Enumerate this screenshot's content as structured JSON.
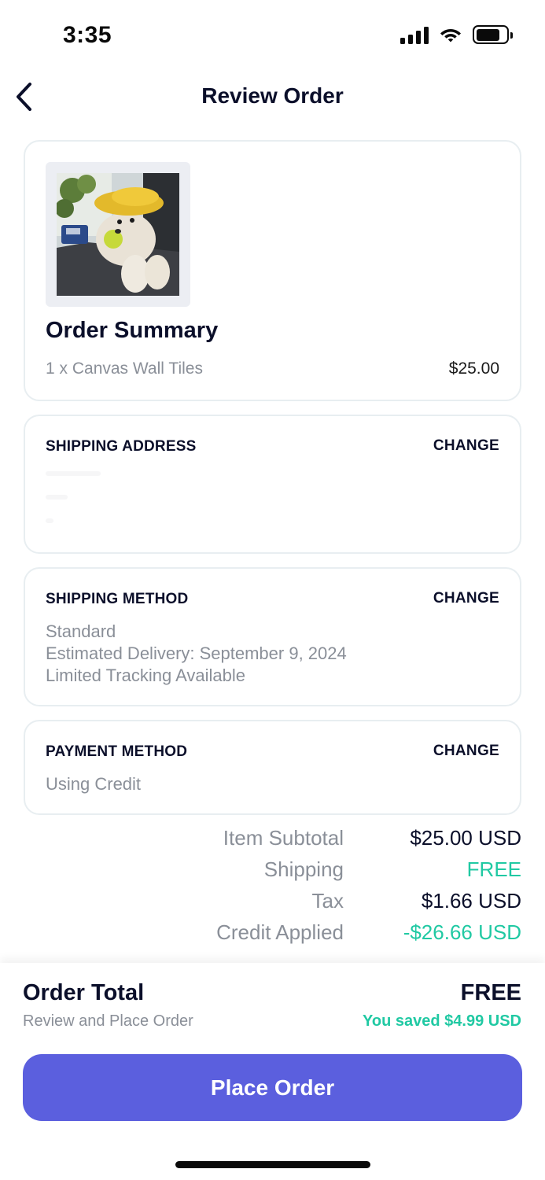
{
  "status_bar": {
    "time": "3:35"
  },
  "header": {
    "title": "Review Order"
  },
  "order_summary": {
    "title": "Order Summary",
    "item": "1 x Canvas Wall Tiles",
    "price": "$25.00"
  },
  "shipping_address": {
    "label": "SHIPPING ADDRESS",
    "change_label": "CHANGE"
  },
  "shipping_method": {
    "label": "SHIPPING METHOD",
    "change_label": "CHANGE",
    "lines": [
      "Standard",
      "Estimated Delivery: September 9, 2024",
      "Limited Tracking Available"
    ]
  },
  "payment_method": {
    "label": "PAYMENT METHOD",
    "change_label": "CHANGE",
    "detail": "Using Credit"
  },
  "totals": [
    {
      "label": "Item Subtotal",
      "value": "$25.00 USD",
      "highlight": false
    },
    {
      "label": "Shipping",
      "value": "FREE",
      "highlight": true
    },
    {
      "label": "Tax",
      "value": "$1.66 USD",
      "highlight": false
    },
    {
      "label": "Credit Applied",
      "value": "-$26.66 USD",
      "highlight": true
    }
  ],
  "footer": {
    "order_total_label": "Order Total",
    "order_total_sub": "Review and Place Order",
    "order_total_value": "FREE",
    "saved_text": "You saved $4.99 USD",
    "place_order_label": "Place Order"
  },
  "colors": {
    "accent": "#5b5fde",
    "success": "#20c9a3",
    "text_primary": "#0b0f2a",
    "text_muted": "#8a8f98"
  }
}
